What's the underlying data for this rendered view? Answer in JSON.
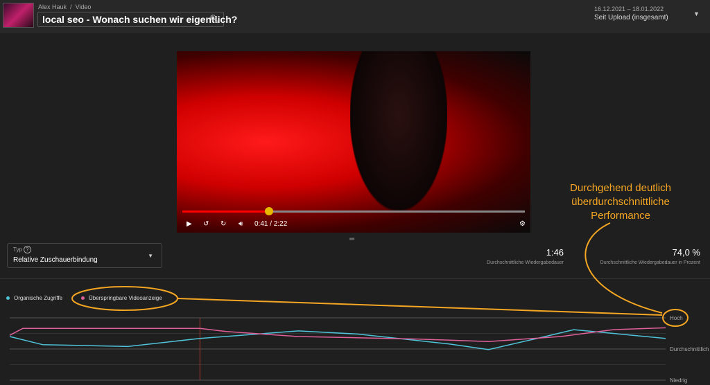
{
  "header": {
    "breadcrumb_channel": "Alex Hauk",
    "breadcrumb_sep": "/",
    "breadcrumb_section": "Video",
    "video_title": "local seo - Wonach suchen wir eigentlich?",
    "search_icon": "search-icon",
    "date_range": "16.12.2021 – 18.01.2022",
    "period": "Seit Upload (insgesamt)"
  },
  "player": {
    "time": "0:41 / 2:22",
    "progress": 0.29,
    "buffered": 0.3,
    "icons": [
      "play-icon",
      "rewind-10-icon",
      "forward-10-icon",
      "volume-icon",
      "settings-icon"
    ]
  },
  "type_select": {
    "label": "Typ",
    "help_icon": "?",
    "value": "Relative Zuschauerbindung"
  },
  "metrics": [
    {
      "value": "1:46",
      "label": "Durchschnittliche Wiedergabedauer"
    },
    {
      "value": "74,0 %",
      "label": "Durchschnittliche Wiedergabedauer in Prozent"
    }
  ],
  "annotation": {
    "lines": [
      "Durchgehend deutlich",
      "überdurchschnittliche",
      "Performance"
    ],
    "color": "#f5a623"
  },
  "chart_data": {
    "type": "line",
    "ytick_labels": [
      "Hoch",
      "Durchschnittlich",
      "Niedrig"
    ],
    "ylim": [
      0,
      1
    ],
    "xlim": [
      0,
      100
    ],
    "current_position_pct": 29,
    "series": [
      {
        "name": "Organische Zugriffe",
        "color": "#4fc3d9",
        "x": [
          0,
          5,
          18,
          29,
          44,
          53,
          67,
          73,
          80,
          86,
          100
        ],
        "y": [
          0.7,
          0.57,
          0.54,
          0.67,
          0.79,
          0.74,
          0.58,
          0.49,
          0.66,
          0.81,
          0.67
        ]
      },
      {
        "name": "Überspringbare Videoanzeige",
        "color": "#e0609a",
        "x": [
          0,
          2,
          29,
          33,
          44,
          62,
          73,
          84,
          92,
          100
        ],
        "y": [
          0.72,
          0.83,
          0.83,
          0.78,
          0.7,
          0.66,
          0.62,
          0.7,
          0.81,
          0.84
        ]
      }
    ]
  }
}
